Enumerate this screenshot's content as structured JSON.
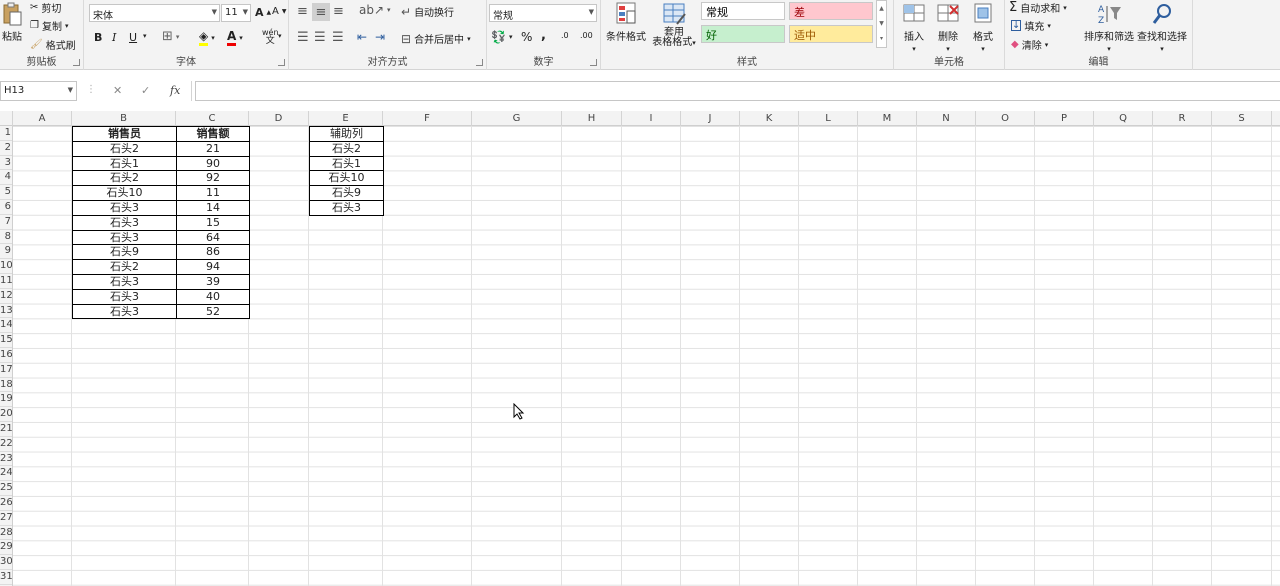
{
  "clipboard": {
    "paste": "粘贴",
    "cut": "剪切",
    "copy": "复制",
    "format_painter": "格式刷",
    "label": "剪贴板"
  },
  "font": {
    "name": "宋体",
    "size": "11",
    "bold": "B",
    "italic": "I",
    "underline": "U",
    "label": "字体",
    "grow": "A",
    "shrink": "A",
    "font_color_letter": "A",
    "phonetic": "wén"
  },
  "alignment": {
    "wrap_text": "自动换行",
    "merge_center": "合并后居中",
    "label": "对齐方式"
  },
  "number": {
    "format": "常规",
    "percent": "%",
    "comma": ",",
    "inc_decimal": ".0",
    "dec_decimal": ".00",
    "label": "数字"
  },
  "styles": {
    "conditional": "条件格式",
    "table_format_1": "套用",
    "table_format_2": "表格格式",
    "cells": [
      {
        "text": "常规",
        "bg": "#ffffff",
        "color": "#000000"
      },
      {
        "text": "差",
        "bg": "#ffc7ce",
        "color": "#9c0006"
      },
      {
        "text": "好",
        "bg": "#c6efce",
        "color": "#006100"
      },
      {
        "text": "适中",
        "bg": "#ffeb9c",
        "color": "#9c5700"
      }
    ],
    "label": "样式"
  },
  "cells_group": {
    "insert": "插入",
    "delete": "删除",
    "format": "格式",
    "label": "单元格"
  },
  "editing": {
    "autosum": "自动求和",
    "fill": "填充",
    "clear": "清除",
    "sort_filter": "排序和筛选",
    "find_select": "查找和选择",
    "label": "编辑"
  },
  "formula_bar": {
    "name_box": "H13",
    "cancel": "✕",
    "enter": "✓",
    "fx": "fx",
    "value": ""
  },
  "columns": [
    "A",
    "B",
    "C",
    "D",
    "E",
    "F",
    "G",
    "H",
    "I",
    "J",
    "K",
    "L",
    "M",
    "N",
    "O",
    "P",
    "Q",
    "R",
    "S"
  ],
  "rows": [
    "1",
    "2",
    "3",
    "4",
    "5",
    "6",
    "7",
    "8",
    "9",
    "10",
    "11",
    "12",
    "13",
    "14",
    "15",
    "16",
    "17",
    "18",
    "19",
    "20",
    "21",
    "22",
    "23",
    "24",
    "25",
    "26",
    "27",
    "28",
    "29",
    "30",
    "31"
  ],
  "sales_table": {
    "headers": [
      "销售员",
      "销售额"
    ],
    "rows": [
      [
        "石头2",
        "21"
      ],
      [
        "石头1",
        "90"
      ],
      [
        "石头2",
        "92"
      ],
      [
        "石头10",
        "11"
      ],
      [
        "石头3",
        "14"
      ],
      [
        "石头3",
        "15"
      ],
      [
        "石头3",
        "64"
      ],
      [
        "石头9",
        "86"
      ],
      [
        "石头2",
        "94"
      ],
      [
        "石头3",
        "39"
      ],
      [
        "石头3",
        "40"
      ],
      [
        "石头3",
        "52"
      ]
    ]
  },
  "helper_table": {
    "header": "辅助列",
    "rows": [
      "石头2",
      "石头1",
      "石头10",
      "石头9",
      "石头3"
    ]
  }
}
